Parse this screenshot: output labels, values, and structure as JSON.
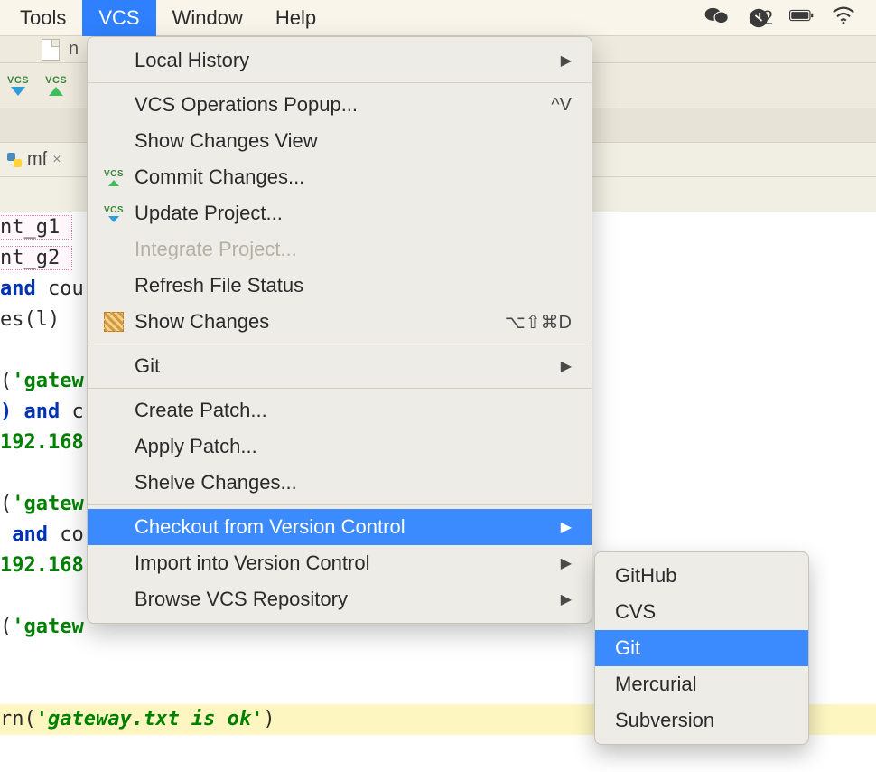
{
  "menubar": {
    "tools": "Tools",
    "vcs": "VCS",
    "window": "Window",
    "help": "Help",
    "notif_count": "2"
  },
  "filestrip": {
    "file_letter": "n"
  },
  "tab": {
    "name": "mf",
    "close": "×"
  },
  "code": {
    "l1a": "nt_g1 ",
    "l2a": "nt_g2 ",
    "l3a": "and",
    "l3b": " cou",
    "l4a": "es(l)",
    "l6a": "(",
    "l6b": "'gatew",
    "l7a": ") and",
    "l7b": " c",
    "l8a": "192.168",
    "l10a": "(",
    "l10b": "'gatew",
    "l11a": " and",
    "l11b": " co",
    "l12a": "192.168",
    "l14a": "(",
    "l14b": "'gatew",
    "last_a": "rn(",
    "last_b": "'gateway.txt is ok'",
    "last_c": ")"
  },
  "dropdown": {
    "local_history": "Local History",
    "vcs_popup": "VCS Operations Popup...",
    "vcs_popup_kb": "^V",
    "show_changes_view": "Show Changes View",
    "commit": "Commit Changes...",
    "update": "Update Project...",
    "integrate": "Integrate Project...",
    "refresh": "Refresh File Status",
    "show_changes": "Show Changes",
    "show_changes_kb": "⌥⇧⌘D",
    "git": "Git",
    "create_patch": "Create Patch...",
    "apply_patch": "Apply Patch...",
    "shelve": "Shelve Changes...",
    "checkout": "Checkout from Version Control",
    "import": "Import into Version Control",
    "browse": "Browse VCS Repository"
  },
  "submenu": {
    "github": "GitHub",
    "cvs": "CVS",
    "git": "Git",
    "mercurial": "Mercurial",
    "subversion": "Subversion"
  }
}
